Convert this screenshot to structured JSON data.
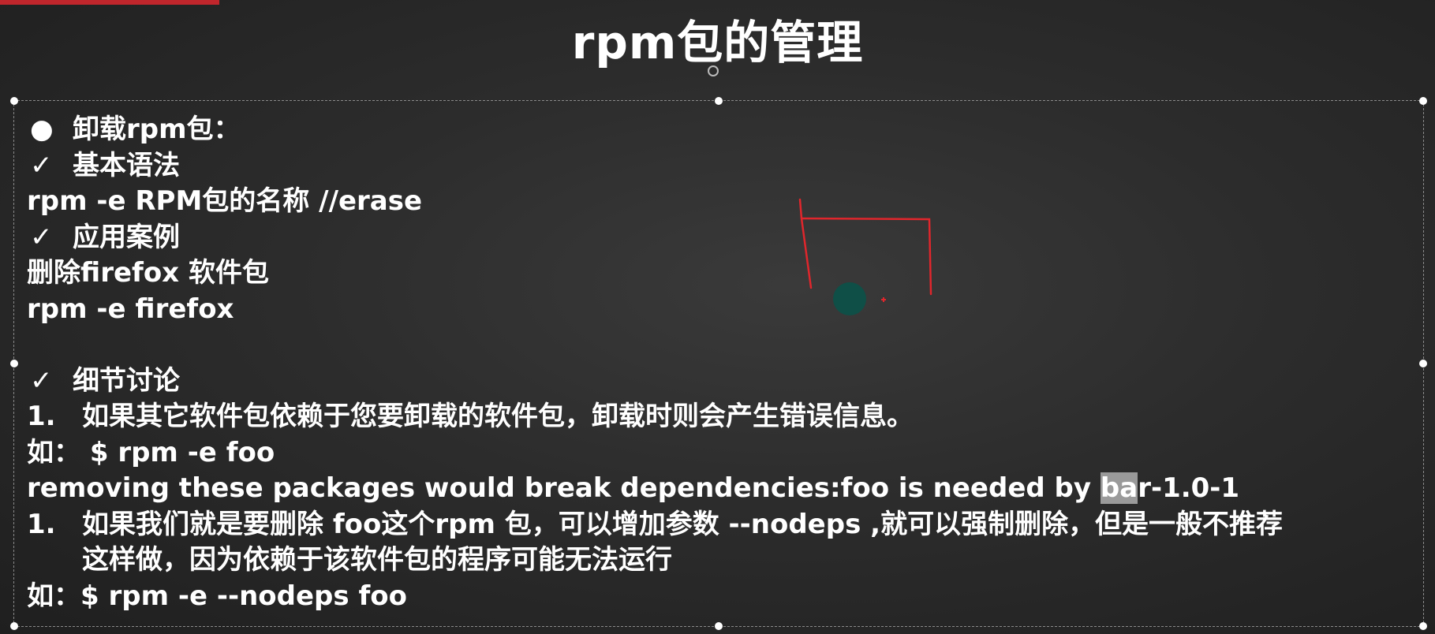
{
  "slide": {
    "title": "rpm包的管理",
    "lines": {
      "l1_bullet": "●",
      "l1_text": "卸载rpm包：",
      "l2_check": "✓",
      "l2_text": "基本语法",
      "l3_text": "rpm -e RPM包的名称  //erase",
      "l4_check": "✓",
      "l4_text": "应用案例",
      "l5_text": "删除firefox  软件包",
      "l6_text": "rpm -e  firefox",
      "l7_check": "✓",
      "l7_text": "细节讨论",
      "l8_num": "1.",
      "l8_text": "如果其它软件包依赖于您要卸载的软件包，卸载时则会产生错误信息。",
      "l9_text": "如：  $ rpm -e  foo",
      "l10_pre": "removing these packages would break dependencies:foo is needed by ",
      "l10_hl": "ba",
      "l10_post": "r-1.0-1",
      "l11_num": "1.",
      "l11_text": "如果我们就是要删除 foo这个rpm 包，可以增加参数 --nodeps ,就可以强制删除，但是一般不推荐",
      "l12_text": "这样做，因为依赖于该软件包的程序可能无法运行",
      "l13_text": "如：$ rpm -e --nodeps foo"
    }
  },
  "colors": {
    "background": "#2c2c2c",
    "text": "#ffffff",
    "accent": "#c0262c",
    "annotation": "#e0262c",
    "pointer": "#0f4f47",
    "highlight": "#9a9a9a"
  }
}
